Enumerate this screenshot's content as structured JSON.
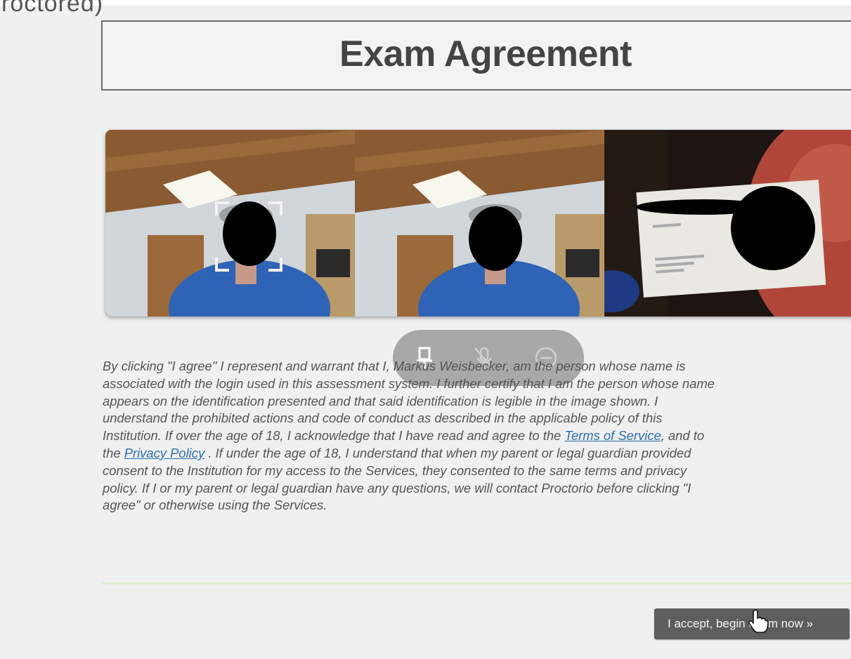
{
  "header": {
    "cut_text": "roctored)"
  },
  "page_title": "Exam Agreement",
  "controls": {
    "icons": [
      "pin-icon",
      "mic-off-icon",
      "minus-circle-icon"
    ]
  },
  "agreement": {
    "lines": [
      "By clicking \"I agree\" I represent and warrant that I, Markus Weisbecker, am the person whose name is",
      "associated with the login used in this assessment system. I further certify that I am the person whose name",
      "appears on the identification presented and that said identification is legible in the image shown. I",
      "understand the prohibited actions and code of conduct as described in the applicable policy of this",
      "Institution. If over the age of 18, I acknowledge that I have read and agree to the ",
      "the ",
      "consent to the Institution for my access to the Services, they consented to the same terms and privacy",
      "policy. If I or my parent or legal guardian have any questions, we will contact Proctorio before clicking \"I",
      "agree\" or otherwise using the Services."
    ],
    "terms_link": "Terms of Service",
    "after_terms": ", and to",
    "privacy_link": "Privacy Policy",
    "after_privacy": " . If under the age of 18, I understand that when my parent or legal guardian provided"
  },
  "accept_button": "I accept, begin exam now »",
  "colors": {
    "accent_link": "#2a6fb0",
    "button_bg": "#5e5e5e",
    "divider": "#dcebd0"
  }
}
